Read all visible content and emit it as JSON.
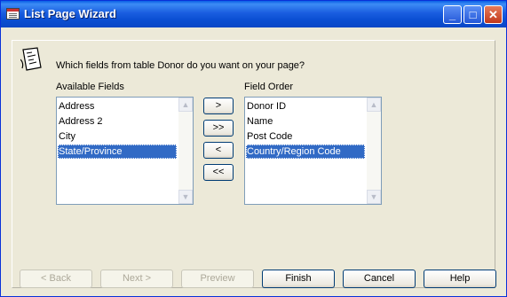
{
  "window": {
    "title": "List Page Wizard",
    "minimize_label": "_",
    "maximize_label": "□",
    "close_label": "✕"
  },
  "question": "Which fields from table Donor do you want on your page?",
  "available": {
    "label": "Available Fields",
    "items": [
      "Address",
      "Address 2",
      "City",
      "State/Province"
    ],
    "selected_index": 3
  },
  "field_order": {
    "label": "Field Order",
    "items": [
      "Donor ID",
      "Name",
      "Post Code",
      "Country/Region Code"
    ],
    "selected_index": 3
  },
  "move_buttons": {
    "add": ">",
    "add_all": ">>",
    "remove": "<",
    "remove_all": "<<"
  },
  "scroll_arrows": {
    "up": "▲",
    "down": "▼"
  },
  "footer": {
    "back": "< Back",
    "next": "Next >",
    "preview": "Preview",
    "finish": "Finish",
    "cancel": "Cancel",
    "help": "Help"
  },
  "colors": {
    "titlebar": "#0a5fe6",
    "selection": "#316ac5",
    "dialog_bg": "#ece9d8"
  }
}
